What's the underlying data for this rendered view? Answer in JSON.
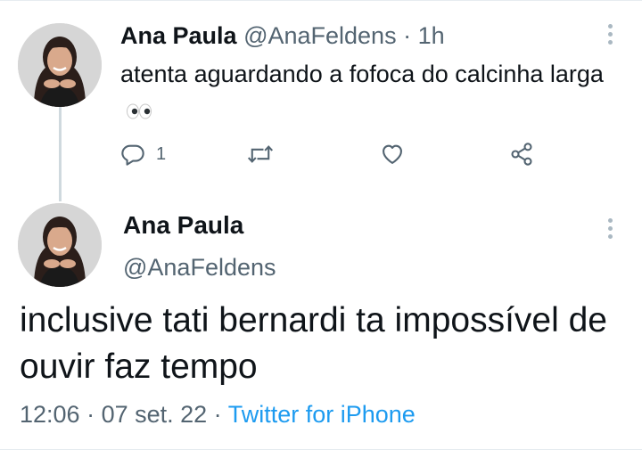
{
  "reply_tweet": {
    "name": "Ana Paula",
    "handle": "@AnaFeldens",
    "separator": " · ",
    "time": "1h",
    "text": "atenta aguardando a fofoca do calcinha larga",
    "emoji_icon": "eyes-emoji-icon",
    "reply_count": "1",
    "actions": [
      "reply-icon",
      "retweet-icon",
      "like-icon",
      "share-icon"
    ]
  },
  "main_tweet": {
    "name": "Ana Paula",
    "handle": "@AnaFeldens",
    "text": "inclusive tati bernardi ta impossível de ouvir faz tempo",
    "time": "12:06",
    "date": "07 set. 22",
    "separator": " · ",
    "source": "Twitter for iPhone"
  },
  "colors": {
    "text": "#0f1419",
    "muted": "#536471",
    "link": "#1d9bf0",
    "thread_line": "#cfd9de",
    "divider": "#e6ecf0"
  }
}
